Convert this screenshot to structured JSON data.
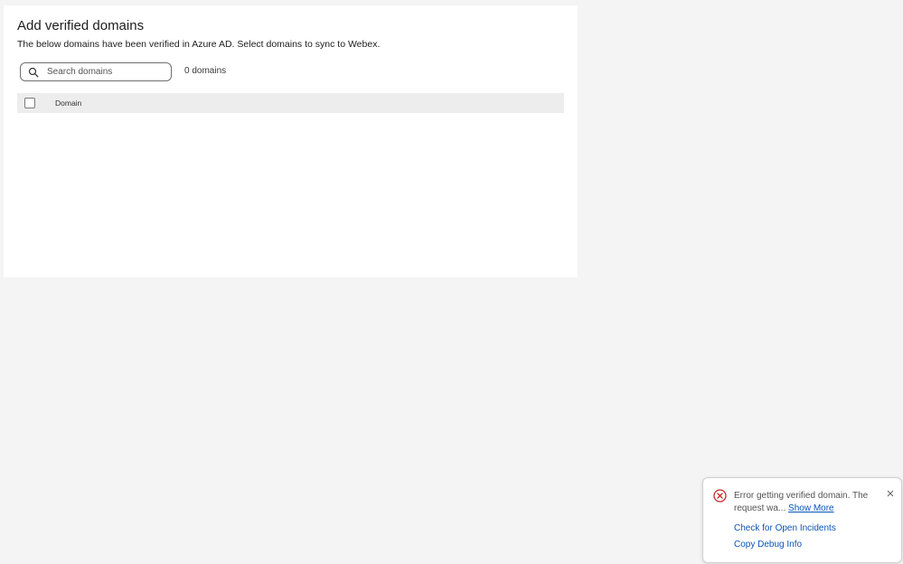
{
  "page": {
    "title": "Add verified domains",
    "subtitle": "The below domains have been verified in Azure AD. Select domains to sync to Webex."
  },
  "search": {
    "placeholder": "Search domains",
    "value": ""
  },
  "domain_count": "0 domains",
  "table": {
    "columns": [
      "Domain"
    ],
    "rows": []
  },
  "toast": {
    "message": "Error getting verified domain. The request wa...",
    "show_more": "Show More",
    "link_incidents": "Check for Open Incidents",
    "link_debug": "Copy Debug Info",
    "status_icon": "error-circle-icon",
    "status_color": "#c62828",
    "link_color": "#0a54b8"
  }
}
